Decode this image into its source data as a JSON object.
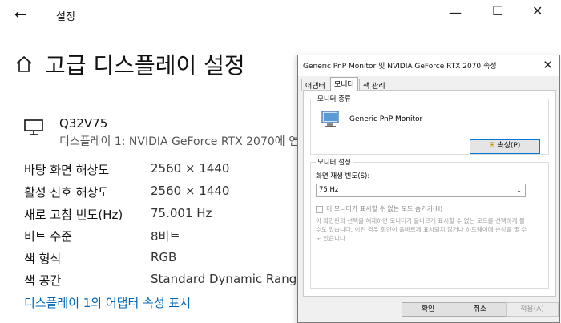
{
  "settings": {
    "window_title": "설정",
    "page_title": "고급 디스플레이 설정",
    "monitor": {
      "name": "Q32V75",
      "description": "디스플레이 1: NVIDIA GeForce RTX 2070에 연"
    },
    "rows": [
      {
        "key": "바탕 화면 해상도",
        "value": "2560 × 1440"
      },
      {
        "key": "활성 신호 해상도",
        "value": "2560 × 1440"
      },
      {
        "key": "새로 고침 빈도(Hz)",
        "value": "75.001 Hz"
      },
      {
        "key": "비트 수준",
        "value": "8비트"
      },
      {
        "key": "색 형식",
        "value": "RGB"
      },
      {
        "key": "색 공간",
        "value": "Standard Dynamic Range("
      }
    ],
    "adapter_link": "디스플레이 1의 어댑터 속성 표시"
  },
  "dialog": {
    "title": "Generic PnP Monitor 및 NVIDIA GeForce RTX 2070 속성",
    "tabs": [
      "어댑터",
      "모니터",
      "색 관리"
    ],
    "active_tab": "모니터",
    "monitor_type_group": "모니터 종류",
    "monitor_type": "Generic PnP Monitor",
    "properties_button": "속성(P)",
    "settings_group": "모니터 설정",
    "refresh_label": "화면 재생 빈도(S):",
    "refresh_value": "75 Hz",
    "hide_modes_label": "이 모니터가 표시할 수 없는 모드 숨기기(H)",
    "hide_modes_desc": "이 확인란의 선택을 해제하면 모니터가 올바르게 표시할 수 없는 모드를 선택하게 될 수도 있습니다. 이런 경우 화면이 올바르게 표시되지 않거나 하드웨어에 손상을 줄 수도 있습니다.",
    "buttons": {
      "ok": "확인",
      "cancel": "취소",
      "apply": "적용(A)"
    }
  }
}
